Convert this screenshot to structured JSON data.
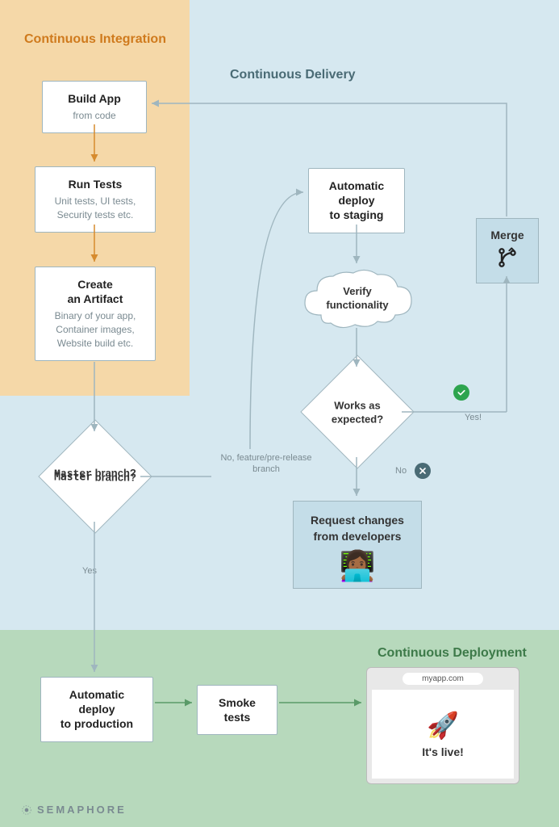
{
  "sections": {
    "ci": "Continuous Integration",
    "cd": "Continuous Delivery",
    "deploy": "Continuous Deployment"
  },
  "nodes": {
    "build": {
      "title": "Build App",
      "sub": "from code"
    },
    "tests": {
      "title": "Run Tests",
      "sub": "Unit tests, UI tests,\nSecurity tests etc."
    },
    "artifact": {
      "title": "Create\nan Artifact",
      "sub": "Binary of your app,\nContainer images,\nWebsite build etc."
    },
    "master_branch": {
      "title": "Master branch?"
    },
    "no_branch": "No,\nfeature/pre-release\nbranch",
    "yes": "Yes",
    "auto_staging": {
      "title": "Automatic\ndeploy\nto staging"
    },
    "verify": {
      "title": "Verify\nfunctionality"
    },
    "works": {
      "title": "Works as\nexpected?"
    },
    "works_yes": "Yes!",
    "works_no": "No",
    "merge": {
      "title": "Merge"
    },
    "request": {
      "title": "Request changes\nfrom developers"
    },
    "auto_prod": {
      "title": "Automatic\ndeploy\nto production"
    },
    "smoke": {
      "title": "Smoke\ntests"
    },
    "browser": {
      "url": "myapp.com",
      "live": "It's live!"
    }
  },
  "brand": "SEMAPHORE",
  "colors": {
    "ci_arrow": "#d68b2e",
    "cd_arrow": "#9fb6bf",
    "deploy_arrow": "#5a9a68"
  }
}
